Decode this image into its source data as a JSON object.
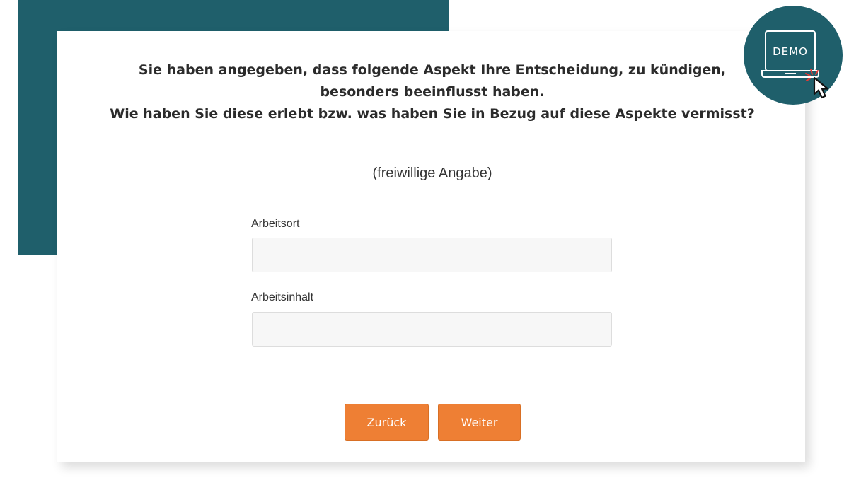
{
  "question": {
    "line1": "Sie haben angegeben, dass folgende Aspekt Ihre Entscheidung, zu kündigen,",
    "line2": "besonders beeinflusst haben.",
    "line3": "Wie haben Sie diese erlebt bzw. was haben Sie in Bezug auf diese Aspekte vermisst?"
  },
  "optional_note": "(freiwillige Angabe)",
  "fields": [
    {
      "label": "Arbeitsort",
      "value": ""
    },
    {
      "label": "Arbeitsinhalt",
      "value": ""
    }
  ],
  "buttons": {
    "back_label": "Zurück",
    "next_label": "Weiter"
  },
  "demo_badge": {
    "text": "DEMO",
    "icons": [
      "laptop-icon",
      "cursor-icon"
    ]
  },
  "colors": {
    "teal": "#1f5f6b",
    "orange": "#ee7f34",
    "input_bg": "#f7f7f7",
    "click_spark": "#e53935"
  }
}
